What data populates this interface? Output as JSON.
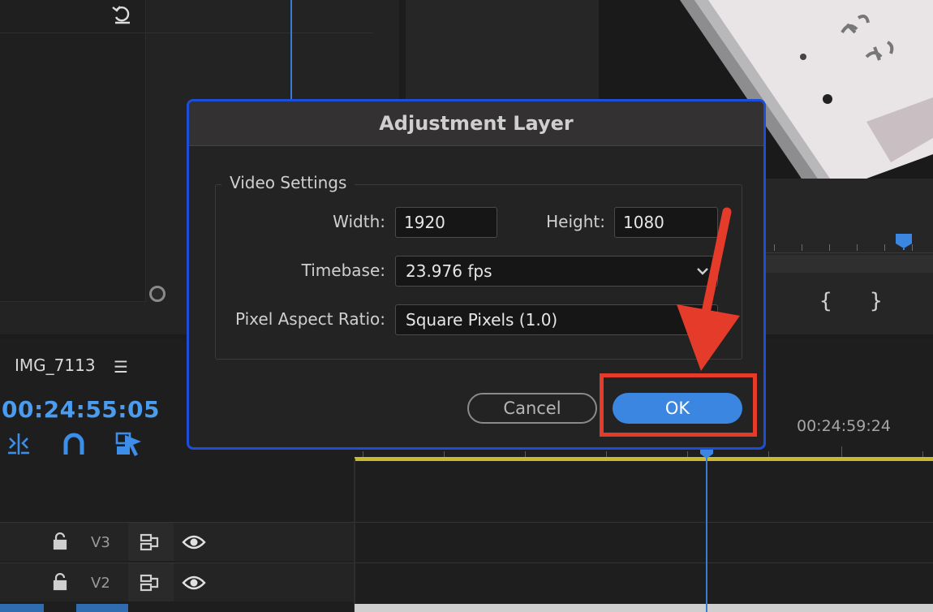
{
  "sequence": {
    "name": "IMG_7113",
    "timecode": "00:24:55:05",
    "ruler_label": "00:24:59:24"
  },
  "tracks": [
    {
      "label": "V3"
    },
    {
      "label": "V2"
    }
  ],
  "dialog": {
    "title": "Adjustment Layer",
    "group_label": "Video Settings",
    "width_label": "Width:",
    "width_value": "1920",
    "height_label": "Height:",
    "height_value": "1080",
    "timebase_label": "Timebase:",
    "timebase_value": "23.976 fps",
    "par_label": "Pixel Aspect Ratio:",
    "par_value": "Square Pixels (1.0)",
    "cancel_label": "Cancel",
    "ok_label": "OK"
  },
  "program": {
    "in_brace": "{",
    "out_brace": "}"
  },
  "colors": {
    "accent": "#3a86e0",
    "timecode": "#4a9cf0",
    "dialog_border": "#1d4ed8",
    "annotation": "#e53b2b",
    "work_area": "#c9b832"
  },
  "icons": {
    "reset": "reset-icon",
    "ripple_edit": "ripple-edit-icon",
    "snap": "magnet-icon",
    "linked_selection": "linked-selection-icon",
    "lock": "lock-icon",
    "sync": "sync-lock-icon",
    "eye": "eye-icon",
    "menu": "hamburger-icon",
    "chevron": "chevron-down-icon"
  }
}
